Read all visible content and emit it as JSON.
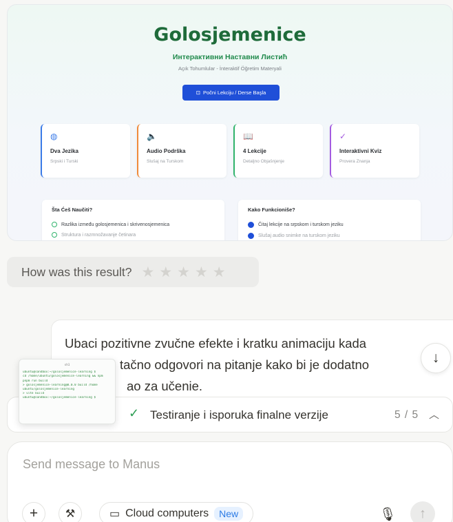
{
  "preview": {
    "title": "Golosjemenice",
    "subtitle": "Интерактивни Наставни Листић",
    "subtitle2": "Açık Tohumlular - İnteraktif Öğretim Materyali",
    "start_button": "Počni Lekciju / Derse Başla",
    "features": [
      {
        "icon": "globe-icon",
        "glyph": "◍",
        "title": "Dva Jezika",
        "desc": "Srpski i Turski"
      },
      {
        "icon": "speaker-icon",
        "glyph": "🔈",
        "title": "Audio Podrška",
        "desc": "Slušaj na Turskom"
      },
      {
        "icon": "book-icon",
        "glyph": "📖",
        "title": "4 Lekcije",
        "desc": "Detaljno Objašnjenje"
      },
      {
        "icon": "check-circle-icon",
        "glyph": "✓",
        "title": "Interaktivni Kviz",
        "desc": "Provera Znanja"
      }
    ],
    "panel_learn": {
      "heading": "Šta Ćeš Naučiti?",
      "item1": "Razlika između golosjemenica i skrivenosjemenica",
      "item2": "Struktura i razmnožavanje četinara"
    },
    "panel_how": {
      "heading": "Kako Funkcioniše?",
      "item1": "Čitaj lekcije na srpskom i turskom jeziku",
      "item2": "Slušaj audio snimke na turskom jeziku"
    }
  },
  "rating": {
    "label": "How was this result?",
    "stars": [
      "★",
      "★",
      "★",
      "★",
      "★"
    ]
  },
  "message": {
    "line1": "Ubaci pozitivne zvučne efekte i kratku animaciju kada",
    "line2": "tačno odgovori na pitanje kako bi je dodatno",
    "line3": "ao za učenie."
  },
  "terminal": {
    "header": "sh1",
    "lines": [
      "ubuntu@sandbox:~/golosjemenice-learning $",
      "cd /home/ubuntu/golosjemenice-learning && npm",
      "pnpm run build",
      "> golosjemenice-learning@0.0.0 build /home",
      "ubuntu/golosjemenice-learning",
      "> vite build",
      "ubuntu@sandbox:~/golosjemenice-learning $"
    ]
  },
  "task": {
    "label": "Testiranje i isporuka finalne verzije",
    "counter": "5 / 5"
  },
  "composer": {
    "placeholder": "Send message to Manus",
    "cloud_label": "Cloud computers",
    "new_badge": "New"
  },
  "colors": {
    "accent_green": "#1e6b3a",
    "button_blue": "#1f4fd8",
    "check_green": "#2e9e54",
    "new_blue": "#2c7be5"
  }
}
